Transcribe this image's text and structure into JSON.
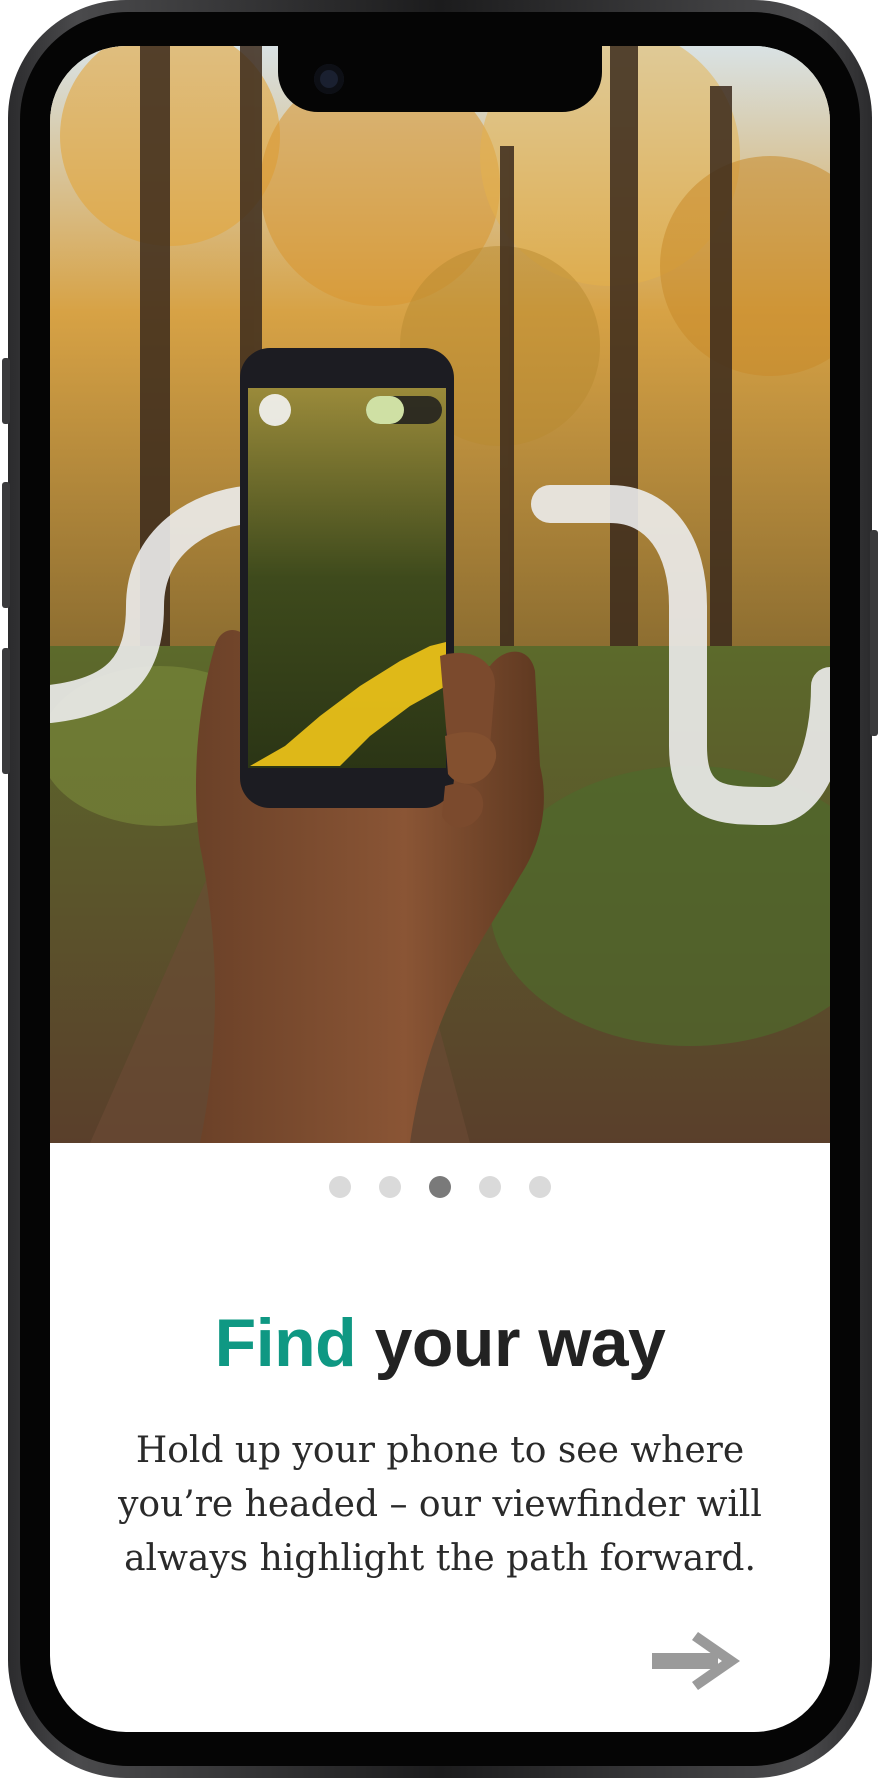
{
  "onboarding": {
    "title_accent": "Find",
    "title_rest": " your way",
    "body": "Hold up your phone to see where you’re headed – our viewfinder will always highlight the path forward.",
    "pager": {
      "total": 5,
      "active_index": 2
    },
    "next_icon": "arrow-right-icon"
  },
  "colors": {
    "accent": "#0f9883",
    "dot_inactive": "#dadada",
    "dot_active": "#7a7a7a",
    "path_highlight": "#f2c618"
  }
}
